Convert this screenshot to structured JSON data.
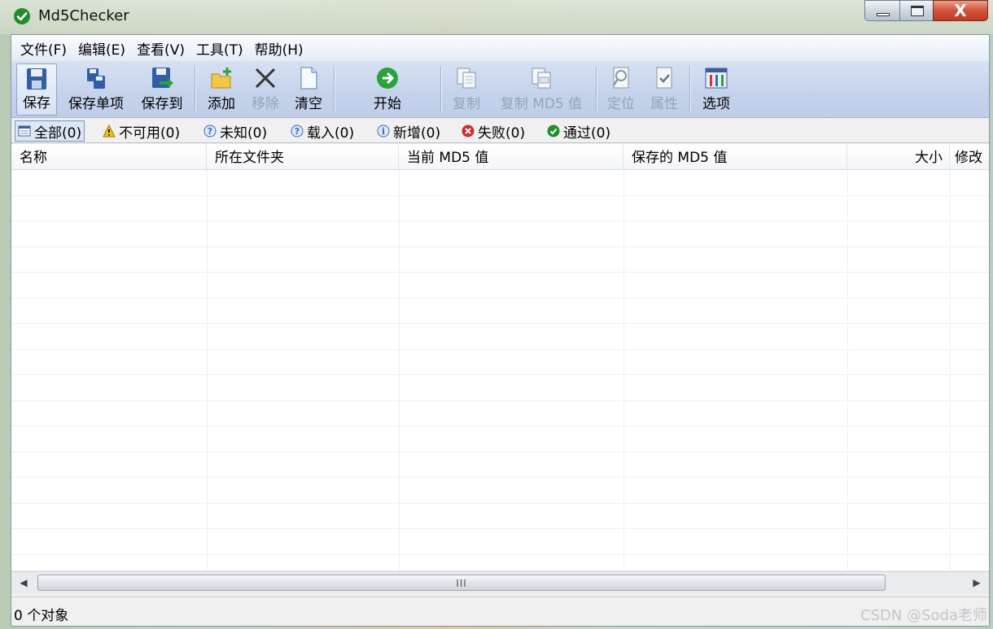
{
  "window": {
    "title": "Md5Checker",
    "minimize_glyph": "—",
    "close_glyph": "X"
  },
  "menubar": {
    "items": [
      {
        "label": "文件(F)"
      },
      {
        "label": "编辑(E)"
      },
      {
        "label": "查看(V)"
      },
      {
        "label": "工具(T)"
      },
      {
        "label": "帮助(H)"
      }
    ]
  },
  "toolbar": {
    "save": "保存",
    "save_item": "保存单项",
    "save_to": "保存到",
    "add": "添加",
    "remove": "移除",
    "clear": "清空",
    "start": "开始",
    "copy": "复制",
    "copy_md5": "复制 MD5 值",
    "locate": "定位",
    "properties": "属性",
    "options": "选项"
  },
  "filters": {
    "all": "全部(0)",
    "unavailable": "不可用(0)",
    "unknown": "未知(0)",
    "loaded": "载入(0)",
    "new": "新增(0)",
    "failed": "失败(0)",
    "passed": "通过(0)"
  },
  "list": {
    "columns": [
      {
        "label": "名称"
      },
      {
        "label": "所在文件夹"
      },
      {
        "label": "当前 MD5 值"
      },
      {
        "label": "保存的 MD5 值"
      },
      {
        "label": "大小"
      },
      {
        "label": "修改"
      }
    ],
    "rows": []
  },
  "scrollbar": {
    "left_arrow": "◀",
    "right_arrow": "▶",
    "grip": "III"
  },
  "status": {
    "text": "0 个对象",
    "watermark": "CSDN @Soda老师"
  },
  "colors": {
    "toolbar_bg": "#c5d3ec",
    "pass_green": "#1f8f2a",
    "fail_red": "#d02b2b",
    "info_blue": "#2f6fc8",
    "warn_yellow": "#f2c40f"
  }
}
